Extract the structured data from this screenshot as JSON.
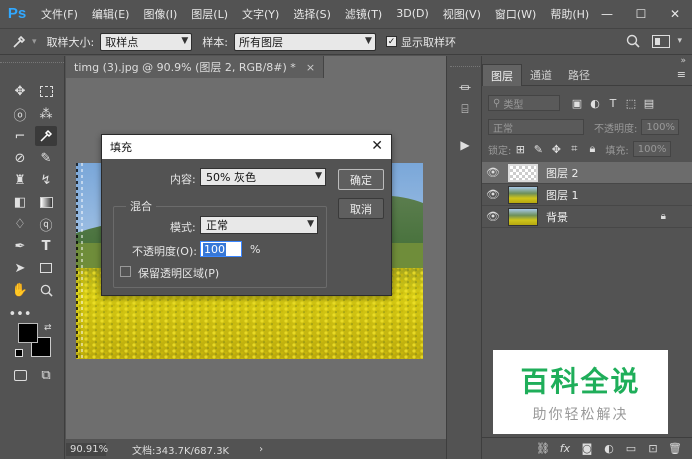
{
  "app": {
    "logo": "Ps"
  },
  "menu": [
    "文件(F)",
    "编辑(E)",
    "图像(I)",
    "图层(L)",
    "文字(Y)",
    "选择(S)",
    "滤镜(T)",
    "3D(D)",
    "视图(V)",
    "窗口(W)",
    "帮助(H)"
  ],
  "window_controls": {
    "minimize": "—",
    "maximize": "☐",
    "close": "✕"
  },
  "options": {
    "sample_size_label": "取样大小:",
    "sample_size_value": "取样点",
    "sample_label": "样本:",
    "sample_value": "所有图层",
    "show_ring_label": "显示取样环",
    "show_ring_checked": true
  },
  "document": {
    "tab_title": "timg (3).jpg @ 90.9% (图层 2, RGB/8#) *",
    "tab_close": "×",
    "zoom": "90.91%",
    "doc_info": "文档:343.7K/687.3K",
    "status_arrow": "›"
  },
  "layers_panel": {
    "tabs": [
      "图层",
      "通道",
      "路径"
    ],
    "active_tab": "图层",
    "filter_label": "类型",
    "blend_mode": "正常",
    "opacity_label": "不透明度:",
    "opacity_value": "100%",
    "lock_label": "锁定:",
    "fill_label": "填充:",
    "fill_value": "100%",
    "layers": [
      {
        "name": "图层 2",
        "selected": true,
        "thumb": "transparent",
        "locked": false
      },
      {
        "name": "图层 1",
        "selected": false,
        "thumb": "photo",
        "locked": false
      },
      {
        "name": "背景",
        "selected": false,
        "thumb": "photo",
        "locked": true
      }
    ]
  },
  "dialog": {
    "title": "填充",
    "content_label": "内容:",
    "content_value": "50% 灰色",
    "ok_label": "确定",
    "cancel_label": "取消",
    "blend_group_title": "混合",
    "mode_label": "模式:",
    "mode_value": "正常",
    "opacity_label": "不透明度(O):",
    "opacity_value": "100",
    "opacity_unit": "%",
    "preserve_label": "保留透明区域(P)",
    "preserve_checked": false
  },
  "watermark": {
    "title": "百科全说",
    "subtitle": "助你轻松解决",
    "title_color": "#1fae5a"
  },
  "colors": {
    "ps_blue": "#31a8ff",
    "panel_bg": "#535353",
    "canvas_bg": "#6e6e6e"
  }
}
